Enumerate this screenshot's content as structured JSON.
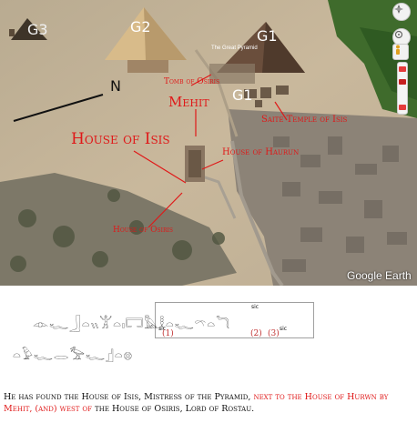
{
  "map": {
    "pyramids": {
      "g1_top": "G1",
      "g1_small": "G1",
      "g2": "G2",
      "g3": "G3"
    },
    "overlay_text": "The Great Pyramid",
    "labels": {
      "north": "N",
      "tomb_of_osiris": "Tomb of Osiris",
      "mehit": "Mehit",
      "house_of_isis": "House of Isis",
      "saite_temple": "Saite Temple of Isis",
      "house_of_haurun": "House of Haurun",
      "house_of_osiris": "House of Osiris"
    },
    "attribution": "Google Earth",
    "controls": {
      "compass_icon": "compass-icon",
      "tilt_icon": "tilt-icon",
      "pegman_icon": "pegman-icon"
    },
    "colors": {
      "label_red": "#e01818"
    }
  },
  "hieroglyphs": {
    "line1": "𓁹𓆑𓃀𓏏𓏭𓀠𓏏𓏤𓉐𓅓𓎛𓏏𓆑𓍼𓏏𓆓",
    "line2": "𓏏𓅱𓆑𓂋𓅡𓆑𓊨𓏏𓊖",
    "sic_marks": [
      "sic",
      "sic",
      "sic"
    ],
    "footnotes": [
      "(1)",
      "(2)",
      "(3)"
    ]
  },
  "caption": {
    "part1": "He has found the House of Isis, Mistress of the Pyramid, ",
    "part2": "next to the House of Hurwn by Mehit, (and) west of",
    "part3": " the House of Osiris, Lord of Rostau."
  }
}
